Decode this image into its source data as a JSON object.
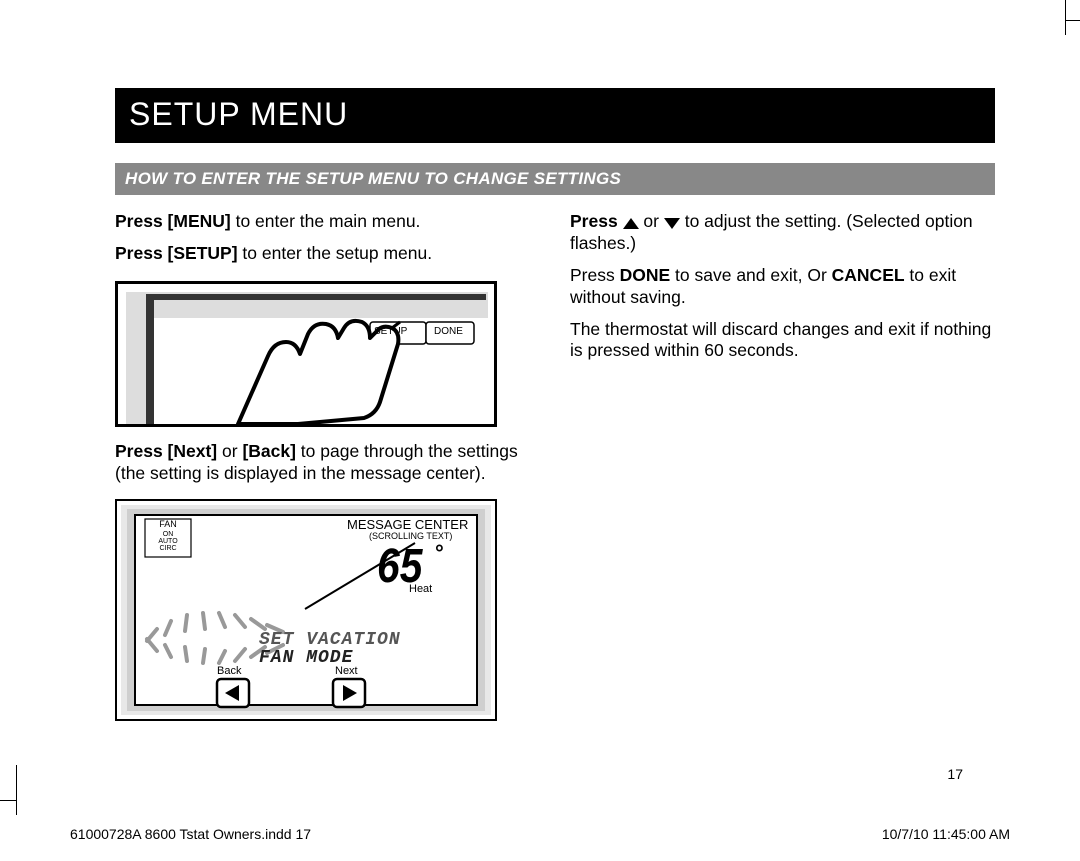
{
  "header": {
    "title": "SETUP MENU"
  },
  "section": {
    "title": "HOW TO ENTER THE SETUP MENU TO CHANGE SETTINGS"
  },
  "left": {
    "p1_bold": "Press [MENU]",
    "p1_rest": " to enter the main menu.",
    "p2_bold": "Press [SETUP]",
    "p2_rest": " to enter the setup menu.",
    "p3_a": "Press [Next]",
    "p3_mid": " or ",
    "p3_b": "[Back]",
    "p3_rest": " to page through the settings (the setting is displayed in the message center).",
    "fig1": {
      "setup_label": "SETUP",
      "done_label": "DONE"
    },
    "fig2": {
      "fan_label": "FAN",
      "fan_opts": [
        "ON",
        "AUTO",
        "CIRC"
      ],
      "msg_center": "MESSAGE CENTER",
      "scrolling": "(SCROLLING TEXT)",
      "temp": "65",
      "degree": "°",
      "heat": "Heat",
      "line1": "SET VACATION",
      "line2": "FAN MODE",
      "back": "Back",
      "next": "Next"
    }
  },
  "right": {
    "p1_a": "Press ",
    "p1_mid": " or ",
    "p1_rest": " to adjust the setting. (Selected option flashes.)",
    "p2_a": "Press ",
    "p2_b": "DONE",
    "p2_mid": " to save and exit, Or ",
    "p2_c": "CANCEL",
    "p2_rest": " to exit without saving.",
    "p3": "The thermostat will discard changes and exit if nothing is pressed within 60 seconds."
  },
  "page_number": "17",
  "footer": {
    "left": "61000728A 8600 Tstat Owners.indd   17",
    "right": "10/7/10   11:45:00 AM"
  }
}
